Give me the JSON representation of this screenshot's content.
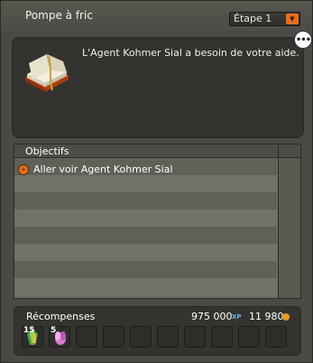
{
  "window": {
    "title": "Pompe à fric",
    "step_select": {
      "selected": "Étape 1"
    }
  },
  "description": {
    "text": "L'Agent Kohmer Sial a besoin de votre aide."
  },
  "objectives": {
    "header": "Objectifs",
    "items": [
      {
        "label": "Aller voir Agent Kohmer Sial"
      }
    ]
  },
  "rewards": {
    "label": "Récompenses",
    "xp": "975 000",
    "xp_unit": "XP",
    "kamas": "11 980",
    "items": [
      {
        "count": "15",
        "icon": "green-gem-icon"
      },
      {
        "count": "5",
        "icon": "pink-flower-icon"
      }
    ],
    "empty_slots": 8
  },
  "colors": {
    "accent": "#e4701f",
    "xp": "#6fb3e8",
    "kamas": "#e89a1a"
  }
}
